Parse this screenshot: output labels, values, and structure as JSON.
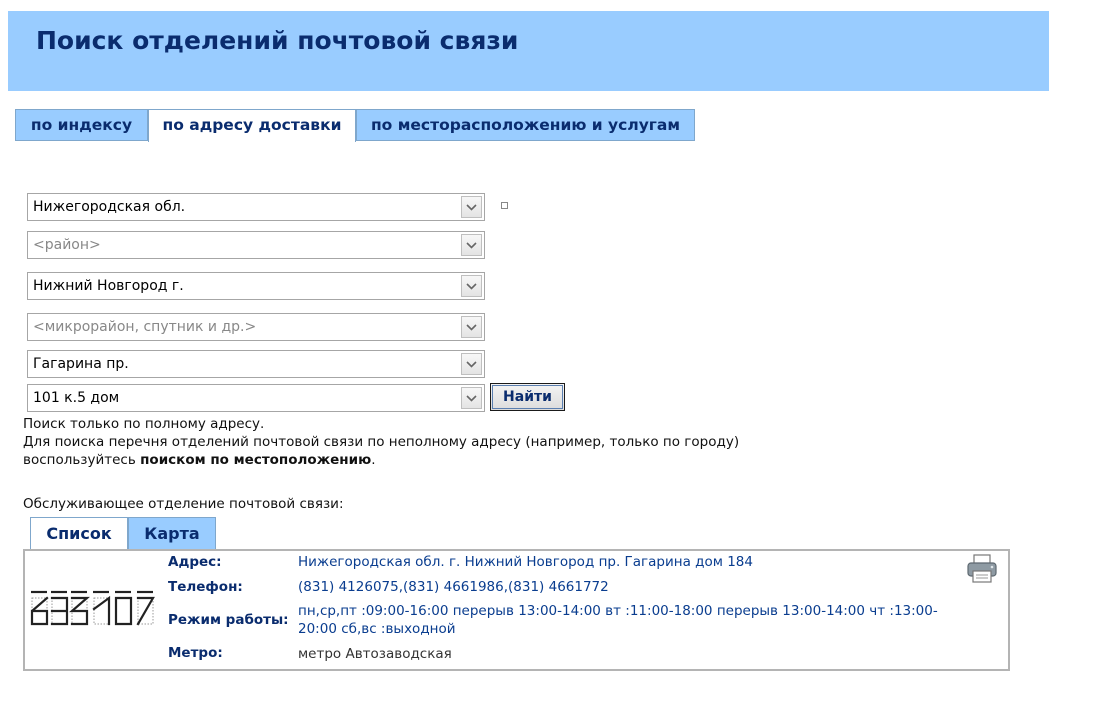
{
  "header": {
    "title": "Поиск отделений почтовой связи"
  },
  "tabs": [
    {
      "label": "по индексу"
    },
    {
      "label": "по адресу доставки"
    },
    {
      "label": "по месторасположению и услугам"
    }
  ],
  "form": {
    "region": "Нижегородская обл.",
    "district_placeholder": "<район>",
    "city": "Нижний Новгород г.",
    "microdistrict_placeholder": "<микрорайон, спутник и др.>",
    "street": "Гагарина пр.",
    "house": "101 к.5 дом",
    "find_label": "Найти"
  },
  "notes": {
    "line1": "Поиск только по полному адресу.",
    "line2": "Для поиска перечня отделений почтовой связи по неполному адресу (например, только по городу)",
    "line3_prefix": "воспользуйтесь ",
    "line3_link": "поиском по местоположению",
    "line3_suffix": "."
  },
  "result": {
    "heading": "Обслуживающее отделение почтовой связи:",
    "tabs": [
      {
        "label": "Список"
      },
      {
        "label": "Карта"
      }
    ],
    "zip": "603107",
    "address_label": "Адрес:",
    "address": "Нижегородская обл. г. Нижний Новгород пр. Гагарина дом 184",
    "phone_label": "Телефон:",
    "phone": "(831) 4126075,(831) 4661986,(831) 4661772",
    "hours_label": "Режим работы:",
    "hours": "пн,ср,пт :09:00-16:00 перерыв 13:00-14:00 вт :11:00-18:00 перерыв 13:00-14:00 чт :13:00-20:00 сб,вс :выходной",
    "metro_label": "Метро:",
    "metro": "метро Автозаводская",
    "print_icon": "printer-icon"
  },
  "colors": {
    "accent": "#99ccff",
    "brand_text": "#0a2c6e"
  }
}
